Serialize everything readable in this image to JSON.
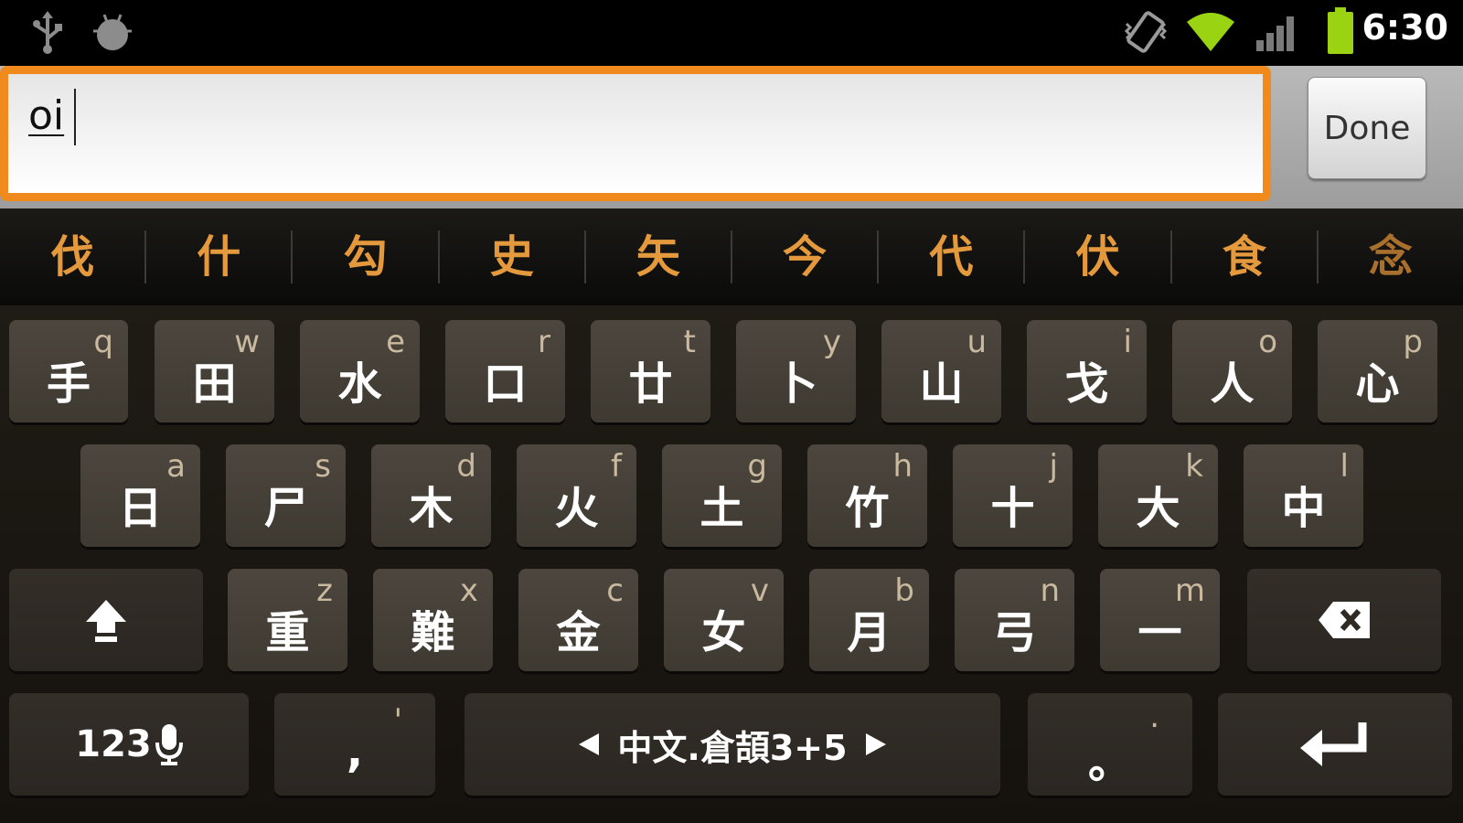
{
  "status_bar": {
    "time": "6:30",
    "icons": [
      "usb-icon",
      "android-debug-icon",
      "vibrate-icon",
      "wifi-icon",
      "signal-icon",
      "battery-icon"
    ]
  },
  "input": {
    "value": "oi",
    "done_label": "Done"
  },
  "candidates": [
    "伐",
    "什",
    "勾",
    "史",
    "矢",
    "今",
    "代",
    "伏",
    "食",
    "念"
  ],
  "keyboard": {
    "row1": [
      {
        "main": "手",
        "sub": "q"
      },
      {
        "main": "田",
        "sub": "w"
      },
      {
        "main": "水",
        "sub": "e"
      },
      {
        "main": "口",
        "sub": "r"
      },
      {
        "main": "廿",
        "sub": "t"
      },
      {
        "main": "卜",
        "sub": "y"
      },
      {
        "main": "山",
        "sub": "u"
      },
      {
        "main": "戈",
        "sub": "i"
      },
      {
        "main": "人",
        "sub": "o"
      },
      {
        "main": "心",
        "sub": "p"
      }
    ],
    "row2": [
      {
        "main": "日",
        "sub": "a"
      },
      {
        "main": "尸",
        "sub": "s"
      },
      {
        "main": "木",
        "sub": "d"
      },
      {
        "main": "火",
        "sub": "f"
      },
      {
        "main": "土",
        "sub": "g"
      },
      {
        "main": "竹",
        "sub": "h"
      },
      {
        "main": "十",
        "sub": "j"
      },
      {
        "main": "大",
        "sub": "k"
      },
      {
        "main": "中",
        "sub": "l"
      }
    ],
    "row3": [
      {
        "main": "重",
        "sub": "z"
      },
      {
        "main": "難",
        "sub": "x"
      },
      {
        "main": "金",
        "sub": "c"
      },
      {
        "main": "女",
        "sub": "v"
      },
      {
        "main": "月",
        "sub": "b"
      },
      {
        "main": "弓",
        "sub": "n"
      },
      {
        "main": "一",
        "sub": "m"
      }
    ],
    "symbols_label": "123",
    "comma": {
      "main": ",",
      "sub": "'"
    },
    "space_label": "中文.倉頡3+5",
    "period": {
      "main": "。",
      "sub": "."
    },
    "colors": {
      "accent": "#f08a1c",
      "candidate": "#e49a3c",
      "key": "#48433b"
    }
  }
}
